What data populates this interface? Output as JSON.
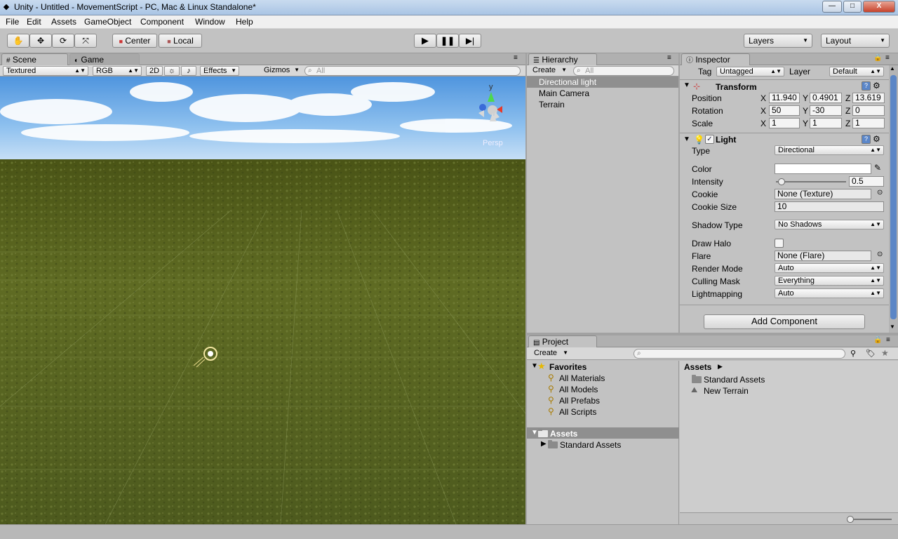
{
  "window": {
    "title": "Unity - Untitled - MovementScript - PC, Mac & Linux Standalone*",
    "minimize": "—",
    "maximize": "□",
    "close": "X"
  },
  "menu": [
    "File",
    "Edit",
    "Assets",
    "GameObject",
    "Component",
    "Window",
    "Help"
  ],
  "toolbar": {
    "tools": [
      "hand-tool",
      "move-tool",
      "rotate-tool",
      "scale-tool"
    ],
    "pivot_center": "Center",
    "pivot_local": "Local",
    "layers": "Layers",
    "layout": "Layout"
  },
  "scene": {
    "tab_scene": "Scene",
    "tab_game": "Game",
    "render_mode": "Textured",
    "color_mode": "RGB",
    "mode_2d": "2D",
    "effects": "Effects",
    "gizmos": "Gizmos",
    "search_placeholder": "All",
    "gizmo": {
      "axis_y": "y",
      "projection": "Persp"
    }
  },
  "hierarchy": {
    "tab": "Hierarchy",
    "create": "Create",
    "search_placeholder": "All",
    "items": [
      "Directional light",
      "Main Camera",
      "Terrain"
    ],
    "selected": "Directional light"
  },
  "inspector": {
    "tab": "Inspector",
    "tag_label": "Tag",
    "tag_value": "Untagged",
    "layer_label": "Layer",
    "layer_value": "Default",
    "transform": {
      "title": "Transform",
      "position_label": "Position",
      "position": {
        "x": "11.940",
        "y": "0.4901",
        "z": "13.619"
      },
      "rotation_label": "Rotation",
      "rotation": {
        "x": "50",
        "y": "-30",
        "z": "0"
      },
      "scale_label": "Scale",
      "scale": {
        "x": "1",
        "y": "1",
        "z": "1"
      },
      "axis_x": "X",
      "axis_y": "Y",
      "axis_z": "Z"
    },
    "light": {
      "title": "Light",
      "enabled": true,
      "type_label": "Type",
      "type": "Directional",
      "color_label": "Color",
      "color_value": "#ffffff",
      "intensity_label": "Intensity",
      "intensity": "0.5",
      "intensity_fraction": 0.06,
      "cookie_label": "Cookie",
      "cookie": "None (Texture)",
      "cookie_size_label": "Cookie Size",
      "cookie_size": "10",
      "shadow_type_label": "Shadow Type",
      "shadow_type": "No Shadows",
      "draw_halo_label": "Draw Halo",
      "draw_halo": false,
      "flare_label": "Flare",
      "flare": "None (Flare)",
      "render_mode_label": "Render Mode",
      "render_mode": "Auto",
      "culling_mask_label": "Culling Mask",
      "culling_mask": "Everything",
      "lightmapping_label": "Lightmapping",
      "lightmapping": "Auto"
    },
    "add_component": "Add Component"
  },
  "project": {
    "tab": "Project",
    "create": "Create",
    "favorites_label": "Favorites",
    "favorites": [
      "All Materials",
      "All Models",
      "All Prefabs",
      "All Scripts"
    ],
    "assets_label": "Assets",
    "assets_tree": [
      "Standard Assets"
    ],
    "breadcrumb": "Assets",
    "assets_list": [
      "Standard Assets",
      "New Terrain"
    ]
  },
  "colors": {
    "sky": "#8fc1ef",
    "ground": "#5f6b23",
    "selection": "#8f8f8f",
    "accent_blue": "#3d6dc9"
  }
}
